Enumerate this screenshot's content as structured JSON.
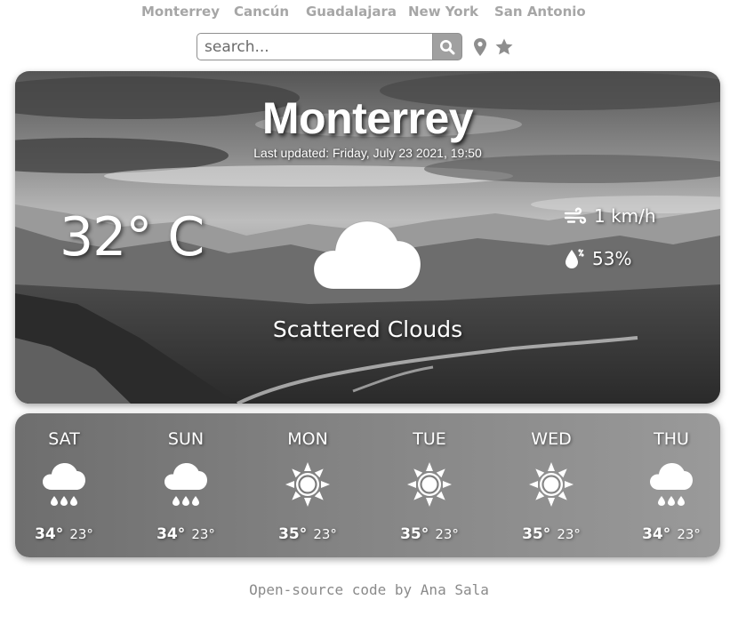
{
  "cities": [
    "Monterrey",
    "Cancún",
    "Guadalajara",
    "New York",
    "San Antonio"
  ],
  "search": {
    "placeholder": "search..."
  },
  "icons": {
    "search": "search-icon",
    "location": "map-pin-icon",
    "favorite": "star-icon"
  },
  "current": {
    "city": "Monterrey",
    "last_updated": "Last updated: Friday, July 23 2021, 19:50",
    "temperature": "32° C",
    "condition": "Scattered Clouds",
    "condition_icon": "cloud-icon",
    "wind": "1 km/h",
    "wind_icon": "wind-icon",
    "humidity": "53%",
    "humidity_icon": "humidity-drop-icon"
  },
  "forecast": [
    {
      "day": "SAT",
      "icon": "rain-cloud-icon",
      "high": "34°",
      "low": "23°"
    },
    {
      "day": "SUN",
      "icon": "rain-cloud-icon",
      "high": "34°",
      "low": "23°"
    },
    {
      "day": "MON",
      "icon": "sun-icon",
      "high": "35°",
      "low": "23°"
    },
    {
      "day": "TUE",
      "icon": "sun-icon",
      "high": "35°",
      "low": "23°"
    },
    {
      "day": "WED",
      "icon": "sun-icon",
      "high": "35°",
      "low": "23°"
    },
    {
      "day": "THU",
      "icon": "rain-cloud-icon",
      "high": "34°",
      "low": "23°"
    }
  ],
  "footer": "Open-source code by Ana Sala",
  "colors": {
    "nav_link": "#a6a6a6",
    "search_button": "#a0a0a0",
    "text_on_card": "#ffffff",
    "footer_text": "#8a8a8a"
  }
}
